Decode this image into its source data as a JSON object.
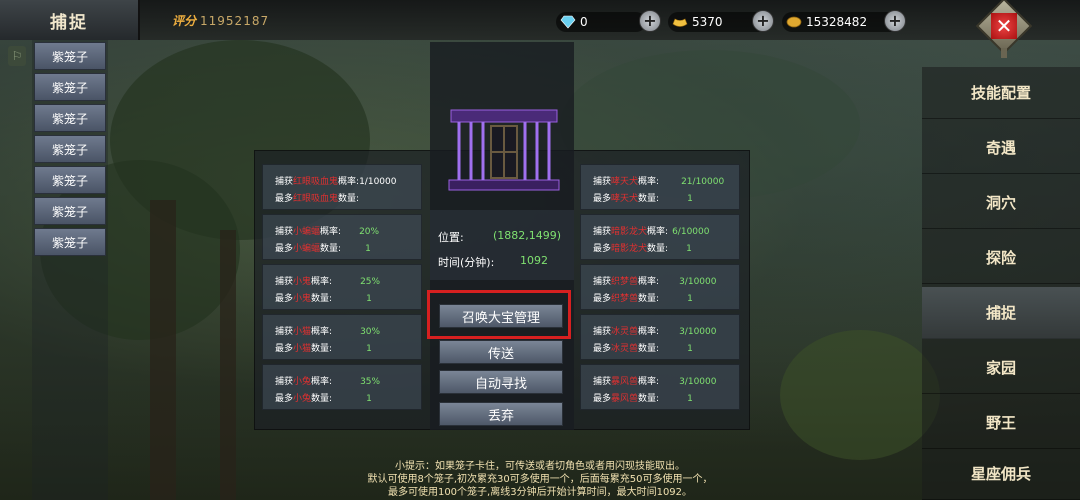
{
  "header": {
    "title": "捕捉",
    "score_label": "评分",
    "score_value": "11952187"
  },
  "currencies": [
    {
      "icon": "diamond-icon",
      "value": "0",
      "color": "#6ad0f0"
    },
    {
      "icon": "gold-ingot-icon",
      "value": "5370",
      "color": "#f0c040"
    },
    {
      "icon": "coin-icon",
      "value": "15328482",
      "color": "#e0a830"
    }
  ],
  "left_list": {
    "items": [
      "紫笼子",
      "紫笼子",
      "紫笼子",
      "紫笼子",
      "紫笼子",
      "紫笼子",
      "紫笼子"
    ]
  },
  "right_menu": {
    "items": [
      "技能配置",
      "奇遇",
      "洞穴",
      "探险",
      "捕捉",
      "家园",
      "野王",
      "星座佣兵"
    ],
    "active_index": 4
  },
  "center": {
    "position_label": "位置:",
    "position_value": "(1882,1499)",
    "time_label": "时间(分钟):",
    "time_value": "1092",
    "buttons": [
      "召唤大宝管理",
      "传送",
      "自动寻找",
      "丢弃"
    ]
  },
  "left_probabilities": [
    {
      "pre": "捕获",
      "name": "红眼吸血鬼",
      "mid": "概率:",
      "rate": "1/10000",
      "max_pre": "最多",
      "max_mid": "数量:",
      "max": ""
    },
    {
      "pre": "捕获",
      "name": "小蝙蝠",
      "mid": "概率:",
      "rate": "20%",
      "max_pre": "最多",
      "max_mid": "数量:",
      "max": "1"
    },
    {
      "pre": "捕获",
      "name": "小鬼",
      "mid": "概率:",
      "rate": "25%",
      "max_pre": "最多",
      "max_mid": "数量:",
      "max": "1"
    },
    {
      "pre": "捕获",
      "name": "小猫",
      "mid": "概率:",
      "rate": "30%",
      "max_pre": "最多",
      "max_mid": "数量:",
      "max": "1"
    },
    {
      "pre": "捕获",
      "name": "小兔",
      "mid": "概率:",
      "rate": "35%",
      "max_pre": "最多",
      "max_mid": "数量:",
      "max": "1"
    }
  ],
  "right_probabilities": [
    {
      "pre": "捕获",
      "name": "哮天犬",
      "mid": "概率:",
      "rate": "21/10000",
      "max_pre": "最多",
      "max_mid": "数量:",
      "max": "1"
    },
    {
      "pre": "捕获",
      "name": "暗影龙犬",
      "mid": "概率:",
      "rate": "6/10000",
      "max_pre": "最多",
      "max_mid": "数量:",
      "max": "1"
    },
    {
      "pre": "捕获",
      "name": "织梦兽",
      "mid": "概率:",
      "rate": "3/10000",
      "max_pre": "最多",
      "max_mid": "数量:",
      "max": "1"
    },
    {
      "pre": "捕获",
      "name": "冰灵兽",
      "mid": "概率:",
      "rate": "3/10000",
      "max_pre": "最多",
      "max_mid": "数量:",
      "max": "1"
    },
    {
      "pre": "捕获",
      "name": "暴风兽",
      "mid": "概率:",
      "rate": "3/10000",
      "max_pre": "最多",
      "max_mid": "数量:",
      "max": "1"
    }
  ],
  "tip": {
    "line1": "小提示：如果笼子卡住，可传送或者切角色或者用闪现技能取出。",
    "line2": "默认可使用8个笼子,初次累充30可多使用一个，后面每累充50可多使用一个，",
    "line3": "最多可使用100个笼子,离线3分钟后开始计算时间，最大时间1092。"
  },
  "colors": {
    "highlight": "#d62020",
    "creature_name": "#e03030",
    "value_green": "#7fe070"
  }
}
